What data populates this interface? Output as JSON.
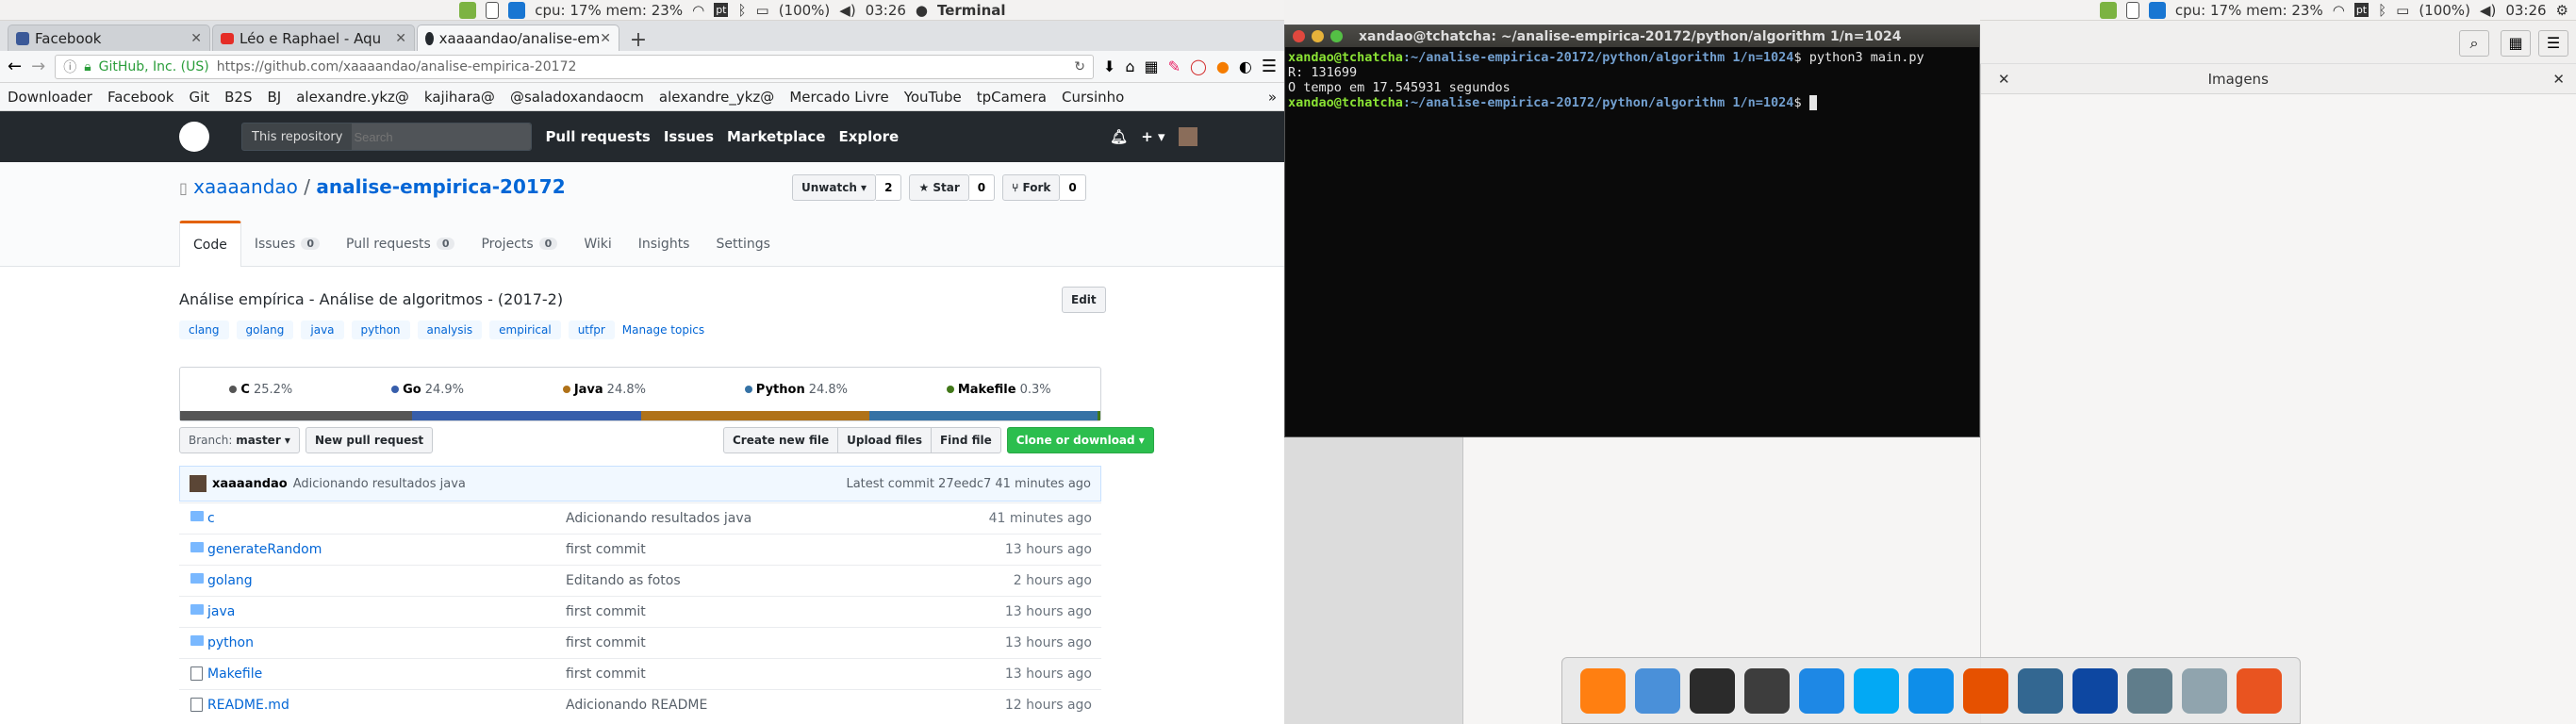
{
  "topbar_left": {
    "cpu": "cpu: 17% mem: 23%",
    "battery": "(100%)",
    "time": "03:26",
    "app": "Terminal"
  },
  "topbar_right": {
    "cpu": "cpu: 17% mem: 23%",
    "battery": "(100%)",
    "time": "03:26"
  },
  "browser": {
    "tabs": [
      {
        "label": "Facebook",
        "active": false
      },
      {
        "label": "Léo e Raphael - Aqu",
        "active": false
      },
      {
        "label": "xaaaandao/analise-em",
        "active": true
      }
    ],
    "url_owner": "GitHub, Inc. (US)",
    "url": "https://github.com/xaaaandao/analise-empirica-20172",
    "bookmarks": [
      "Downloader",
      "Facebook",
      "Git",
      "B2S",
      "BJ",
      "alexandre.ykz@",
      "kajihara@",
      "@saladoxandaocm",
      "alexandre_ykz@",
      "Mercado Livre",
      "YouTube",
      "tpCamera",
      "Cursinho"
    ],
    "overflow": "»"
  },
  "github": {
    "search_scope": "This repository",
    "search_placeholder": "Search",
    "nav": [
      "Pull requests",
      "Issues",
      "Marketplace",
      "Explore"
    ],
    "owner": "xaaaandao",
    "sep": "/",
    "repo": "analise-empirica-20172",
    "unwatch": "Unwatch ▾",
    "unwatch_count": "2",
    "star": "Star",
    "star_count": "0",
    "fork": "Fork",
    "fork_count": "0",
    "tabs": [
      {
        "label": "Code",
        "count": ""
      },
      {
        "label": "Issues",
        "count": "0"
      },
      {
        "label": "Pull requests",
        "count": "0"
      },
      {
        "label": "Projects",
        "count": "0"
      },
      {
        "label": "Wiki",
        "count": ""
      },
      {
        "label": "Insights",
        "count": ""
      },
      {
        "label": "Settings",
        "count": ""
      }
    ],
    "description": "Análise empírica - Análise de algoritmos - (2017-2)",
    "edit": "Edit",
    "topics": [
      "clang",
      "golang",
      "java",
      "python",
      "analysis",
      "empirical",
      "utfpr"
    ],
    "manage_topics": "Manage topics",
    "languages": [
      {
        "name": "C",
        "pct": "25.2%",
        "value": 25.2,
        "color": "#555555"
      },
      {
        "name": "Go",
        "pct": "24.9%",
        "value": 24.9,
        "color": "#375eab"
      },
      {
        "name": "Java",
        "pct": "24.8%",
        "value": 24.8,
        "color": "#b07219"
      },
      {
        "name": "Python",
        "pct": "24.8%",
        "value": 24.8,
        "color": "#3572A5"
      },
      {
        "name": "Makefile",
        "pct": "0.3%",
        "value": 0.3,
        "color": "#427819"
      }
    ],
    "branch_label": "Branch:",
    "branch": "master ▾",
    "new_pr": "New pull request",
    "create_file": "Create new file",
    "upload": "Upload files",
    "find": "Find file",
    "clone": "Clone or download ▾",
    "commit_author": "xaaaandao",
    "commit_msg": "Adicionando resultados java",
    "latest_commit": "Latest commit 27eedc7 41 minutes ago",
    "files": [
      {
        "name": "c",
        "msg": "Adicionando resultados java",
        "age": "41 minutes ago",
        "type": "dir"
      },
      {
        "name": "generateRandom",
        "msg": "first commit",
        "age": "13 hours ago",
        "type": "dir"
      },
      {
        "name": "golang",
        "msg": "Editando as fotos",
        "age": "2 hours ago",
        "type": "dir"
      },
      {
        "name": "java",
        "msg": "first commit",
        "age": "13 hours ago",
        "type": "dir"
      },
      {
        "name": "python",
        "msg": "first commit",
        "age": "13 hours ago",
        "type": "dir"
      },
      {
        "name": "Makefile",
        "msg": "first commit",
        "age": "13 hours ago",
        "type": "file"
      },
      {
        "name": "README.md",
        "msg": "Adicionando README",
        "age": "12 hours ago",
        "type": "file"
      }
    ]
  },
  "terminal": {
    "title": "xandao@tchatcha: ~/analise-empirica-20172/python/algorithm 1/n=1024",
    "prompt_user": "xandao@tchatcha",
    "prompt_path": ":~/analise-empirica-20172/python/algorithm 1/n=1024",
    "cmd": "$ python3 main.py",
    "out1": "R: 131699",
    "out2": "O tempo em 17.545931 segundos",
    "prompt2_end": "$ "
  },
  "imagens": {
    "title": "Imagens"
  },
  "dock_apps": [
    "firefox-icon",
    "finder-icon",
    "terminal-icon",
    "editor-icon",
    "dropbox-icon",
    "skype-icon",
    "teamviewer-icon",
    "matlab-icon",
    "postgres-icon",
    "mysql-icon",
    "drive-icon",
    "virtualbox-icon",
    "ubuntu-icon"
  ]
}
